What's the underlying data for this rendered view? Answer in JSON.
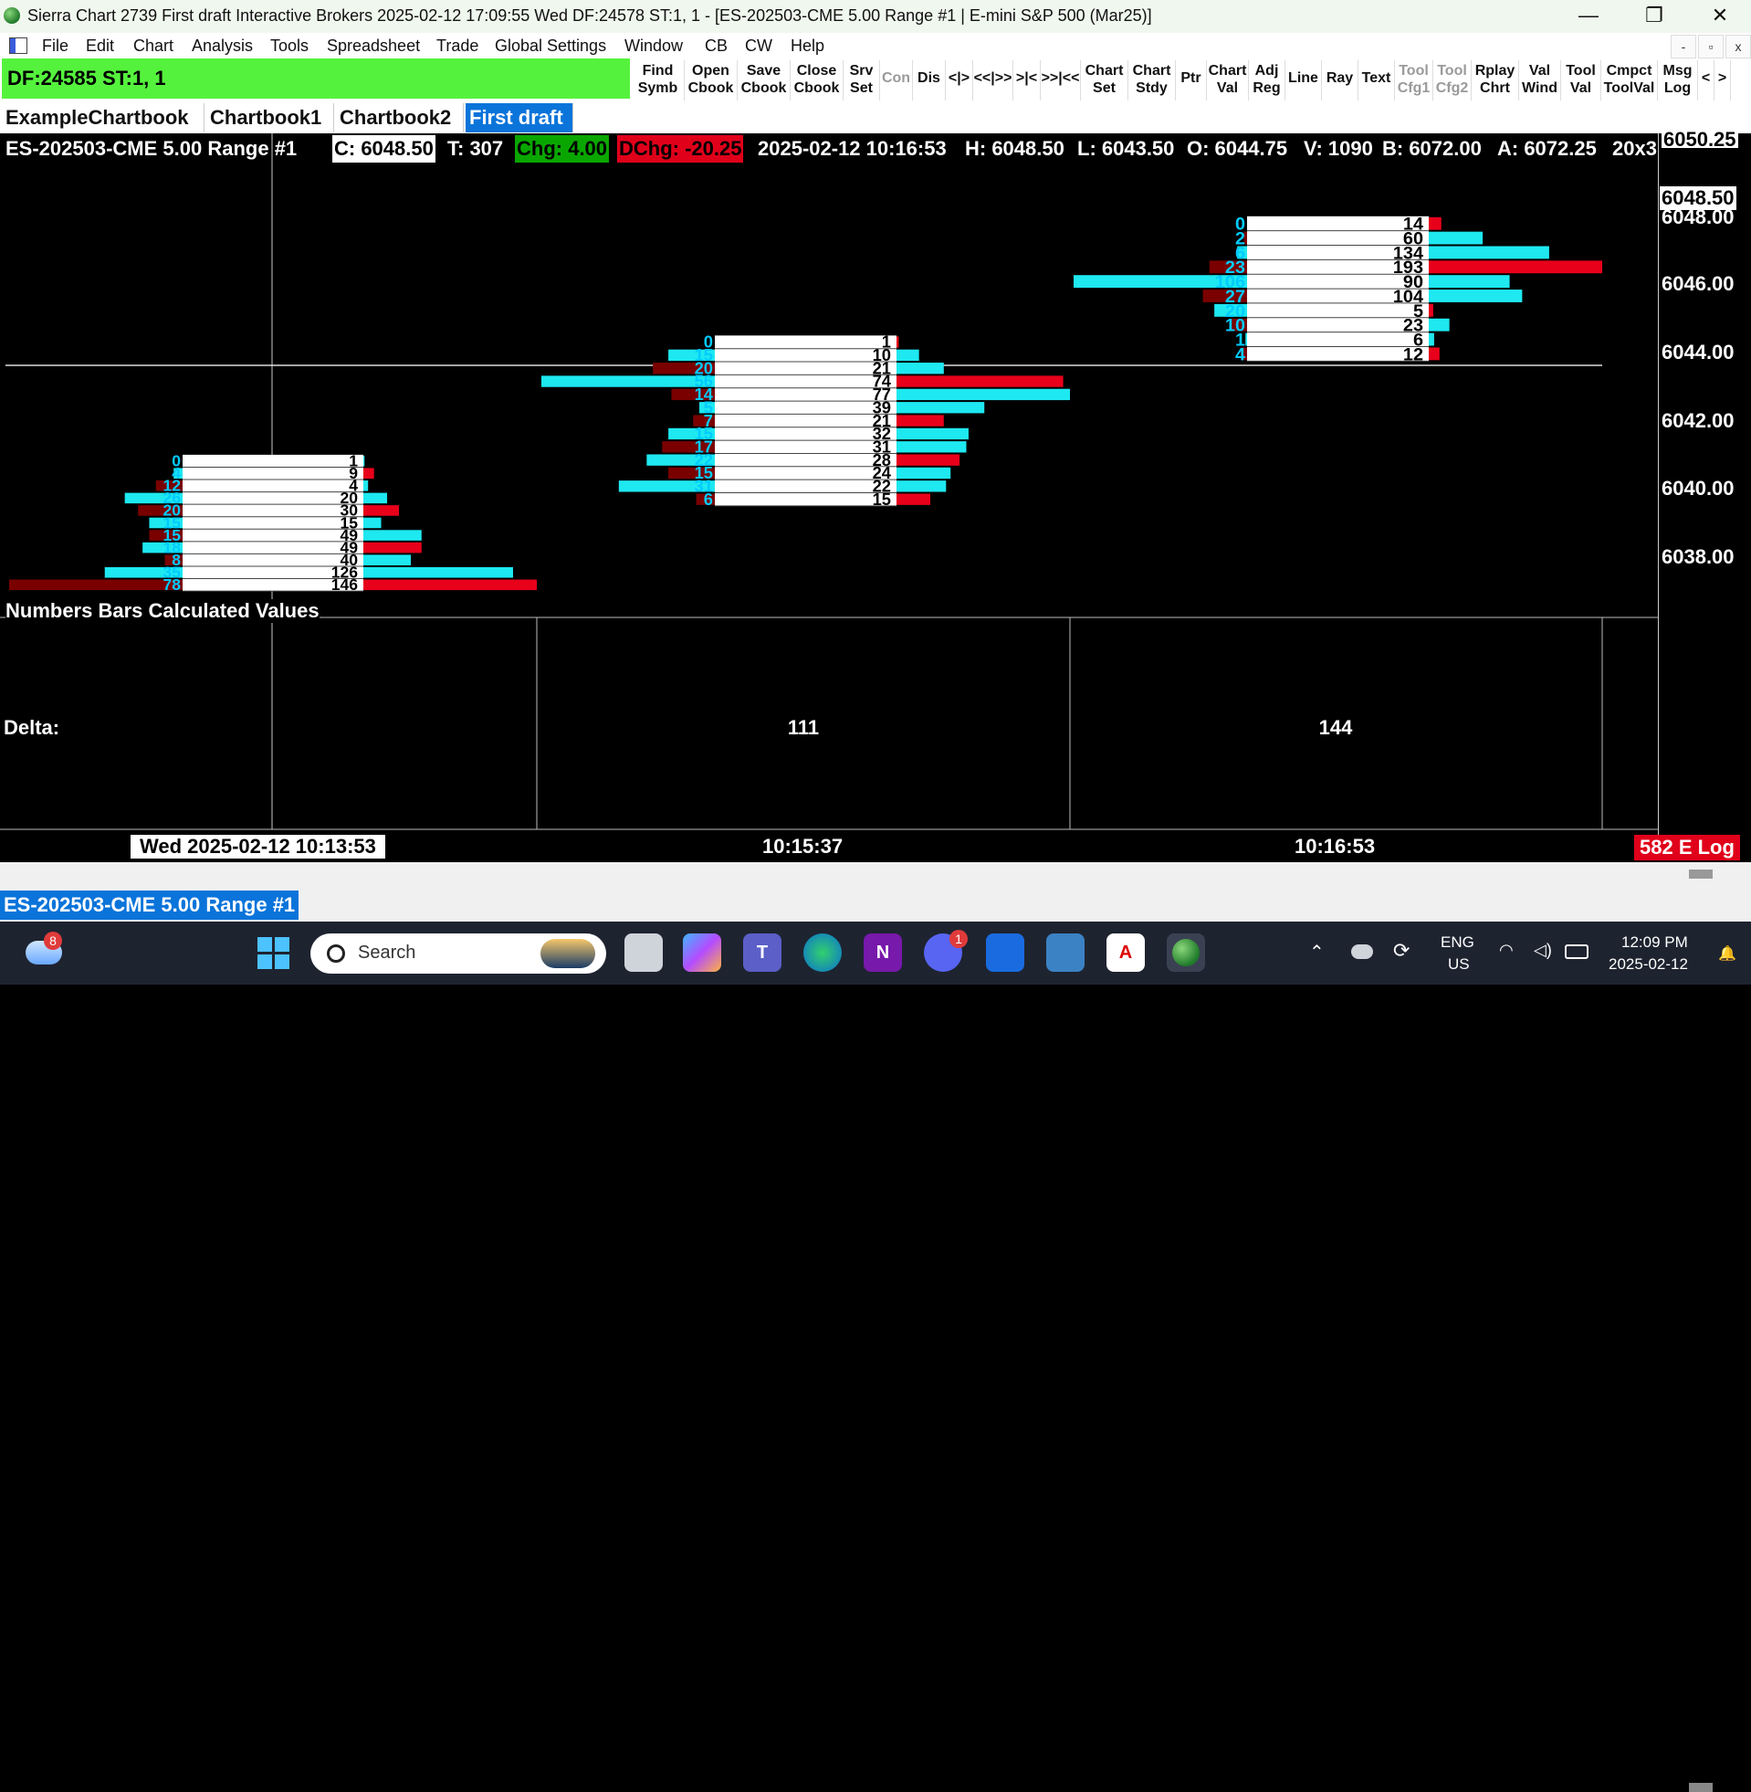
{
  "window": {
    "title": "Sierra Chart 2739 First draft Interactive Brokers 2025-02-12  17:09:55 Wed DF:24578  ST:1, 1 - [ES-202503-CME  5.00 Range #1 | E-mini S&P 500 (Mar25)]",
    "minimize": "—",
    "restore": "❐",
    "close": "✕"
  },
  "menu": [
    "File",
    "Edit",
    "Chart",
    "Analysis",
    "Tools",
    "Spreadsheet",
    "Trade",
    "Global Settings",
    "Window",
    "CB",
    "CW",
    "Help"
  ],
  "mdi_buttons": [
    "-",
    "▫",
    "x"
  ],
  "status": {
    "df_st": "DF:24585  ST:1, 1"
  },
  "toolbar": [
    {
      "l1": "Find",
      "l2": "Symb",
      "disabled": false
    },
    {
      "l1": "Open",
      "l2": "Cbook",
      "disabled": false
    },
    {
      "l1": "Save",
      "l2": "Cbook",
      "disabled": false
    },
    {
      "l1": "Close",
      "l2": "Cbook",
      "disabled": false
    },
    {
      "l1": "Srv",
      "l2": "Set",
      "disabled": false
    },
    {
      "l1": "Con",
      "l2": "",
      "disabled": true
    },
    {
      "l1": "Dis",
      "l2": "",
      "disabled": false
    },
    {
      "l1": "<|>",
      "l2": "",
      "disabled": false
    },
    {
      "l1": "<<|>>",
      "l2": "",
      "disabled": false
    },
    {
      "l1": ">|<",
      "l2": "",
      "disabled": false
    },
    {
      "l1": ">>|<<",
      "l2": "",
      "disabled": false
    },
    {
      "l1": "Chart",
      "l2": "Set",
      "disabled": false
    },
    {
      "l1": "Chart",
      "l2": "Stdy",
      "disabled": false
    },
    {
      "l1": "Ptr",
      "l2": "",
      "disabled": false
    },
    {
      "l1": "Chart",
      "l2": "Val",
      "disabled": false
    },
    {
      "l1": "Adj",
      "l2": "Reg",
      "disabled": false
    },
    {
      "l1": "Line",
      "l2": "",
      "disabled": false
    },
    {
      "l1": "Ray",
      "l2": "",
      "disabled": false
    },
    {
      "l1": "Text",
      "l2": "",
      "disabled": false
    },
    {
      "l1": "Tool",
      "l2": "Cfg1",
      "disabled": true
    },
    {
      "l1": "Tool",
      "l2": "Cfg2",
      "disabled": true
    },
    {
      "l1": "Rplay",
      "l2": "Chrt",
      "disabled": false
    },
    {
      "l1": "Val",
      "l2": "Wind",
      "disabled": false
    },
    {
      "l1": "Tool",
      "l2": "Val",
      "disabled": false
    },
    {
      "l1": "Cmpct",
      "l2": "ToolVal",
      "disabled": false
    },
    {
      "l1": "Msg",
      "l2": "Log",
      "disabled": false
    },
    {
      "l1": "<",
      "l2": "",
      "disabled": false
    },
    {
      "l1": ">",
      "l2": "",
      "disabled": false
    }
  ],
  "tabs": [
    {
      "label": "ExampleChartbook",
      "active": false
    },
    {
      "label": "Chartbook1",
      "active": false
    },
    {
      "label": "Chartbook2",
      "active": false
    },
    {
      "label": "First draft",
      "active": true
    }
  ],
  "chart_header": {
    "symbol": "ES-202503-CME  5.00 Range #1",
    "close": "C: 6048.50",
    "trades": "T: 307",
    "chg": "Chg: 4.00",
    "dchg": "DChg: -20.25",
    "datetime": "2025-02-12 10:16:53",
    "high": "H: 6048.50",
    "low": "L: 6043.50",
    "open": "O: 6044.75",
    "volume": "V: 1090",
    "bid": "B: 6072.00",
    "ask": "A: 6072.25",
    "more": "20x3"
  },
  "price_scale": {
    "top_partial": "6050.25",
    "last_price": "6048.50",
    "labels": [
      "6048.00",
      "6046.00",
      "6044.00",
      "6042.00",
      "6040.00",
      "6038.00"
    ]
  },
  "study": {
    "name": "Numbers Bars Calculated Values"
  },
  "delta": {
    "label": "Delta:",
    "values": [
      "111",
      "144"
    ]
  },
  "time_axis": {
    "cursor_time": "Wed 2025-02-12  10:13:53",
    "labels": [
      "10:15:37",
      "10:16:53"
    ]
  },
  "elog": "582 E Log",
  "chart_name": "ES-202503-CME  5.00 Range #1",
  "colors": {
    "ask": "#1ee8f0",
    "bid_dark": "#7a0000",
    "bid": "#e8001a",
    "status_green": "#55f23d",
    "tab_active": "#0a74da"
  },
  "chart_data": {
    "type": "bar",
    "title": "ES-202503-CME  5.00 Range #1",
    "ylim": [
      6037,
      6050.25
    ],
    "bars": [
      {
        "time": "10:13:53",
        "high": 6041.0,
        "low": 6037.0,
        "bid_vol": [
          78,
          35,
          8,
          18,
          15,
          15,
          20,
          26,
          12,
          4,
          0
        ],
        "ask_vol": [
          146,
          126,
          40,
          49,
          49,
          15,
          30,
          20,
          4,
          9,
          1
        ]
      },
      {
        "time": "10:15:37",
        "high": 6044.5,
        "low": 6039.5,
        "bid_vol": [
          6,
          31,
          15,
          22,
          17,
          15,
          7,
          5,
          14,
          56,
          20,
          15,
          0
        ],
        "ask_vol": [
          15,
          22,
          24,
          28,
          31,
          32,
          21,
          39,
          77,
          74,
          21,
          10,
          1
        ]
      },
      {
        "time": "10:16:53",
        "high": 6048.0,
        "low": 6043.75,
        "bid_vol": [
          4,
          1,
          10,
          20,
          27,
          106,
          23,
          6,
          2,
          0
        ],
        "ask_vol": [
          12,
          6,
          23,
          5,
          104,
          90,
          193,
          134,
          60,
          14
        ]
      }
    ]
  },
  "taskbar": {
    "weather_badge": "8",
    "search_placeholder": "Search",
    "discord_badge": "1",
    "lang1": "ENG",
    "lang2": "US",
    "time": "12:09 PM",
    "date": "2025-02-12",
    "apps": [
      "task-view",
      "copilot",
      "teams",
      "edge",
      "onenote",
      "discord",
      "board",
      "notepad",
      "acrobat",
      "sierra-chart"
    ]
  }
}
